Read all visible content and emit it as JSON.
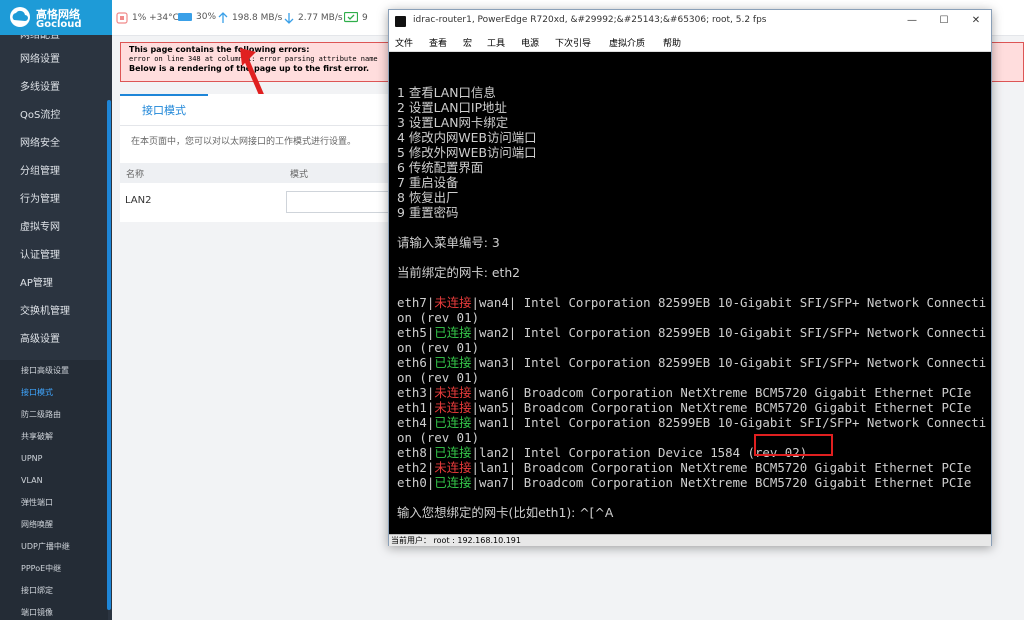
{
  "logo": {
    "name": "高恪网络",
    "sub": "Gocloud"
  },
  "sidebar": {
    "cut_item": "网络配置",
    "items": [
      "网络设置",
      "多线设置",
      "QoS流控",
      "网络安全",
      "分组管理",
      "行为管理",
      "虚拟专网",
      "认证管理",
      "AP管理",
      "交换机管理",
      "高级设置"
    ],
    "subitems": [
      "接口高级设置",
      "接口模式",
      "防二级路由",
      "共享破解",
      "UPNP",
      "VLAN",
      "弹性端口",
      "网络唤醒",
      "UDP广播中继",
      "PPPoE中继",
      "接口绑定",
      "端口镜像"
    ],
    "active_sub": "接口模式"
  },
  "topbar": {
    "cpu": "1% +34°C",
    "ram": "30%",
    "upload": "198.8 MB/s",
    "download": "2.77 MB/s",
    "online": "9"
  },
  "error": {
    "line1": "This page contains the following errors:",
    "line2": "error on line 348 at column 1: error parsing attribute name",
    "line3": "Below is a rendering of the page up to the first error."
  },
  "panel": {
    "tab": "接口模式",
    "description": "在本页面中，您可以对以太网接口的工作模式进行设置。",
    "columns": [
      "名称",
      "模式"
    ],
    "row": {
      "name": "LAN2",
      "mode": ""
    }
  },
  "window": {
    "title": "idrac-router1, PowerEdge R720xd, &#29992;&#25143;&#65306; root, 5.2 fps",
    "buttons": [
      "—",
      "☐",
      "✕"
    ],
    "menu": [
      "文件",
      "查看",
      "宏",
      "工具",
      "电源",
      "下次引导",
      "虚拟介质",
      "帮助"
    ],
    "status": "当前用户： root : 192.168.10.191"
  },
  "terminal": {
    "menu": [
      "1 查看LAN口信息",
      "2 设置LAN口IP地址",
      "3 设置LAN网卡绑定",
      "4 修改内网WEB访问端口",
      "5 修改外网WEB访问端口",
      "6 传统配置界面",
      "7 重启设备",
      "8 恢复出厂",
      "9 重置密码"
    ],
    "prompt_menu": "请输入菜单编号: 3",
    "current_nic": "当前绑定的网卡: eth2",
    "nics": [
      {
        "eth": "eth7",
        "status": "未连接",
        "state": "off",
        "wan": "wan4",
        "desc": "Intel Corporation 82599EB 10-Gigabit SFI/SFP+ Network Connecti",
        "cont": "on (rev 01)"
      },
      {
        "eth": "eth5",
        "status": "已连接",
        "state": "on",
        "wan": "wan2",
        "desc": "Intel Corporation 82599EB 10-Gigabit SFI/SFP+ Network Connecti",
        "cont": "on (rev 01)"
      },
      {
        "eth": "eth6",
        "status": "已连接",
        "state": "on",
        "wan": "wan3",
        "desc": "Intel Corporation 82599EB 10-Gigabit SFI/SFP+ Network Connecti",
        "cont": "on (rev 01)"
      },
      {
        "eth": "eth3",
        "status": "未连接",
        "state": "off",
        "wan": "wan6",
        "desc": "Broadcom Corporation NetXtreme BCM5720 Gigabit Ethernet PCIe",
        "cont": ""
      },
      {
        "eth": "eth1",
        "status": "未连接",
        "state": "off",
        "wan": "wan5",
        "desc": "Broadcom Corporation NetXtreme BCM5720 Gigabit Ethernet PCIe",
        "cont": ""
      },
      {
        "eth": "eth4",
        "status": "已连接",
        "state": "on",
        "wan": "wan1",
        "desc": "Intel Corporation 82599EB 10-Gigabit SFI/SFP+ Network Connecti",
        "cont": "on (rev 01)"
      },
      {
        "eth": "eth8",
        "status": "已连接",
        "state": "on",
        "wan": "lan2",
        "desc": "Intel Corporation Device 1584 (rev 02)",
        "cont": ""
      },
      {
        "eth": "eth2",
        "status": "未连接",
        "state": "off",
        "wan": "lan1",
        "desc": "Broadcom Corporation NetXtreme BCM5720 Gigabit Ethernet PCIe",
        "cont": ""
      },
      {
        "eth": "eth0",
        "status": "已连接",
        "state": "on",
        "wan": "wan7",
        "desc": "Broadcom Corporation NetXtreme BCM5720 Gigabit Ethernet PCIe",
        "cont": ""
      }
    ],
    "input_prompt": "输入您想绑定的网卡(比如eth1): ^[^A"
  },
  "colors": {
    "brand": "#1e9bd7",
    "accent": "#1e86d8",
    "sidebar": "#2b3440",
    "connected": "#34c84a",
    "disconnected": "#e83b3b",
    "highlight": "#e02020"
  }
}
